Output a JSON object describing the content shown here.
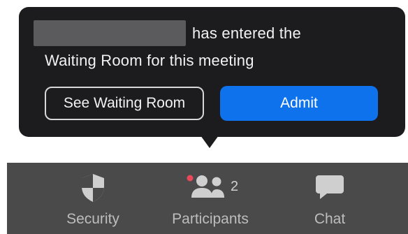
{
  "notification": {
    "redacted_name": "",
    "message_line1": "has entered the",
    "message_line2": "Waiting Room for this meeting",
    "see_waiting_room_label": "See Waiting Room",
    "admit_label": "Admit"
  },
  "toolbar": {
    "security": {
      "label": "Security",
      "icon": "shield-icon"
    },
    "participants": {
      "label": "Participants",
      "icon": "participants-icon",
      "count": "2"
    },
    "chat": {
      "label": "Chat",
      "icon": "chat-bubble-icon"
    }
  },
  "colors": {
    "popover_bg": "#1c1c1e",
    "admit_bg": "#0e72ed",
    "toolbar_bg": "#4a4a4a",
    "notification_dot": "#e8495a"
  }
}
